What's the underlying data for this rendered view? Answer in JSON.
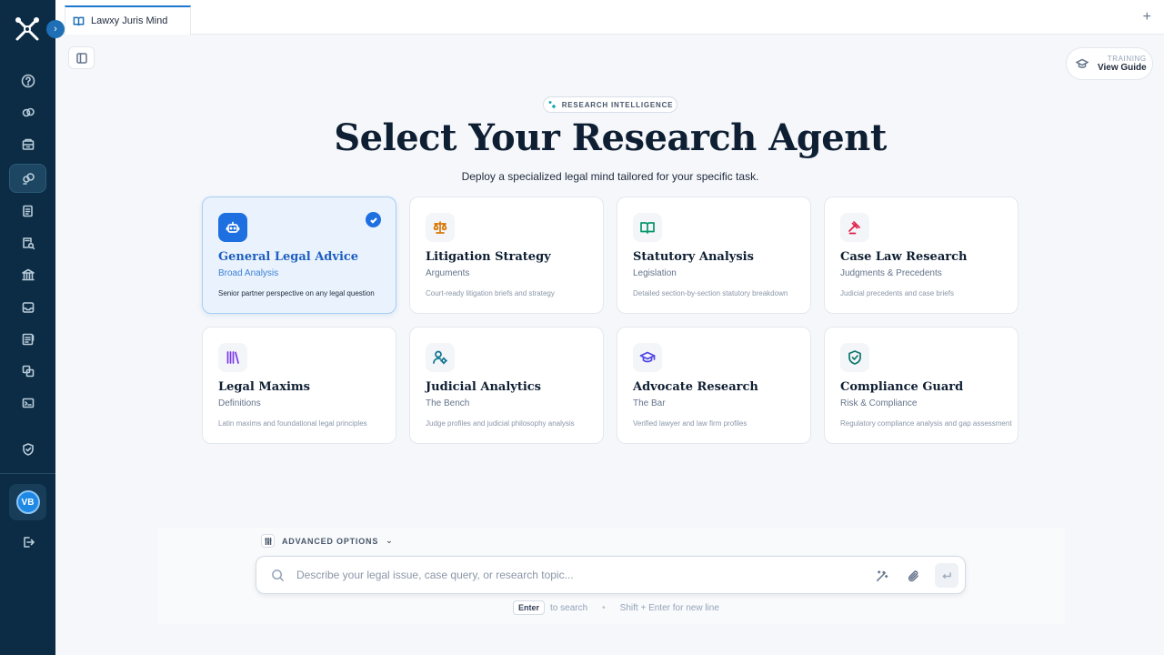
{
  "app": {
    "tab_title": "Lawxy Juris Mind",
    "user_initials": "VB"
  },
  "sidebar": {
    "items": [
      {
        "name": "help-icon"
      },
      {
        "name": "link-icon"
      },
      {
        "name": "archive-icon"
      },
      {
        "name": "agents-icon",
        "active": true
      },
      {
        "name": "documents-icon"
      },
      {
        "name": "search-document-icon"
      },
      {
        "name": "courthouse-icon"
      },
      {
        "name": "inbox-icon"
      },
      {
        "name": "notes-icon"
      },
      {
        "name": "translate-icon"
      },
      {
        "name": "terminal-icon"
      },
      {
        "name": "shield-icon"
      }
    ]
  },
  "training": {
    "label": "TRAINING",
    "action": "View Guide"
  },
  "header": {
    "badge": "RESEARCH INTELLIGENCE",
    "title": "Select Your Research Agent",
    "subtitle": "Deploy a specialized legal mind tailored for your specific task."
  },
  "agents": [
    {
      "title": "General Legal Advice",
      "subtitle": "Broad Analysis",
      "description": "Senior partner perspective on any legal question",
      "selected": true,
      "icon": "robot-icon",
      "color": "#ffffff"
    },
    {
      "title": "Litigation Strategy",
      "subtitle": "Arguments",
      "description": "Court-ready litigation briefs and strategy",
      "icon": "scales-icon",
      "color": "#d97706"
    },
    {
      "title": "Statutory Analysis",
      "subtitle": "Legislation",
      "description": "Detailed section-by-section statutory breakdown",
      "icon": "book-icon",
      "color": "#059669"
    },
    {
      "title": "Case Law Research",
      "subtitle": "Judgments & Precedents",
      "description": "Judicial precedents and case briefs",
      "icon": "gavel-icon",
      "color": "#e11d48"
    },
    {
      "title": "Legal Maxims",
      "subtitle": "Definitions",
      "description": "Latin maxims and foundational legal principles",
      "icon": "library-icon",
      "color": "#7c3aed"
    },
    {
      "title": "Judicial Analytics",
      "subtitle": "The Bench",
      "description": "Judge profiles and judicial philosophy analysis",
      "icon": "user-cog-icon",
      "color": "#0e7490"
    },
    {
      "title": "Advocate Research",
      "subtitle": "The Bar",
      "description": "Verified lawyer and law firm profiles",
      "icon": "graduation-cap-icon",
      "color": "#4f46e5"
    },
    {
      "title": "Compliance Guard",
      "subtitle": "Risk & Compliance",
      "description": "Regulatory compliance analysis and gap assessment",
      "icon": "shield-check-icon",
      "color": "#0f766e"
    }
  ],
  "input": {
    "advanced_label": "ADVANCED OPTIONS",
    "placeholder": "Describe your legal issue, case query, or research topic...",
    "value": ""
  },
  "hints": {
    "key": "Enter",
    "key_text": "to search",
    "shift_text": "Shift + Enter for new line"
  }
}
